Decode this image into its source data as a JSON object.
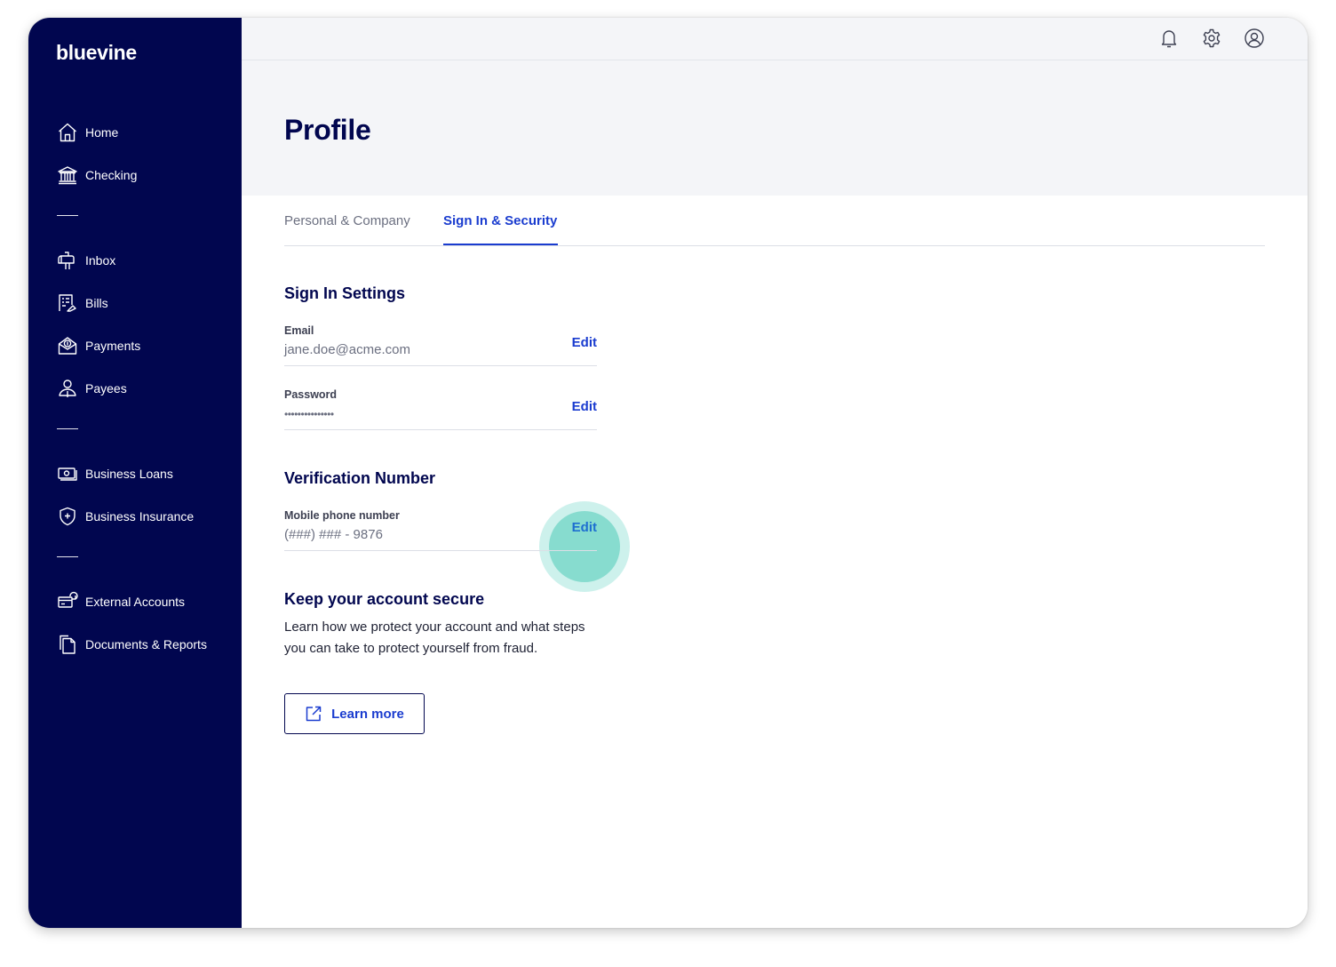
{
  "brand": {
    "name": "bluevine"
  },
  "sidebar": {
    "items": [
      {
        "id": "home",
        "label": "Home",
        "icon": "home-icon"
      },
      {
        "id": "checking",
        "label": "Checking",
        "icon": "bank-icon"
      },
      {
        "id": "inbox",
        "label": "Inbox",
        "icon": "mailbox-icon"
      },
      {
        "id": "bills",
        "label": "Bills",
        "icon": "bill-icon"
      },
      {
        "id": "payments",
        "label": "Payments",
        "icon": "payment-icon"
      },
      {
        "id": "payees",
        "label": "Payees",
        "icon": "person-icon"
      },
      {
        "id": "business-loans",
        "label": "Business Loans",
        "icon": "cash-icon"
      },
      {
        "id": "business-insurance",
        "label": "Business Insurance",
        "icon": "shield-icon"
      },
      {
        "id": "external-accounts",
        "label": "External Accounts",
        "icon": "external-card-icon"
      },
      {
        "id": "documents-reports",
        "label": "Documents & Reports",
        "icon": "documents-icon"
      }
    ]
  },
  "topbar": {
    "icons": [
      "bell-icon",
      "gear-icon",
      "user-circle-icon"
    ]
  },
  "page": {
    "title": "Profile"
  },
  "tabs": [
    {
      "label": "Personal & Company",
      "active": false
    },
    {
      "label": "Sign In & Security",
      "active": true
    }
  ],
  "sign_in": {
    "title": "Sign In Settings",
    "email": {
      "label": "Email",
      "value": "jane.doe@acme.com",
      "edit": "Edit"
    },
    "password": {
      "label": "Password",
      "value": "•••••••••••••••",
      "edit": "Edit"
    }
  },
  "verification": {
    "title": "Verification Number",
    "phone": {
      "label": "Mobile phone number",
      "value": "(###) ### - 9876",
      "edit": "Edit"
    }
  },
  "secure": {
    "title": "Keep your account secure",
    "text": "Learn how we protect your account and what steps you can take to protect yourself from fraud.",
    "button": "Learn more"
  },
  "colors": {
    "sidebar_bg": "#01064f",
    "accent": "#1a3ccf",
    "highlight": "#87dccf",
    "header_bg": "#f4f5f8"
  }
}
